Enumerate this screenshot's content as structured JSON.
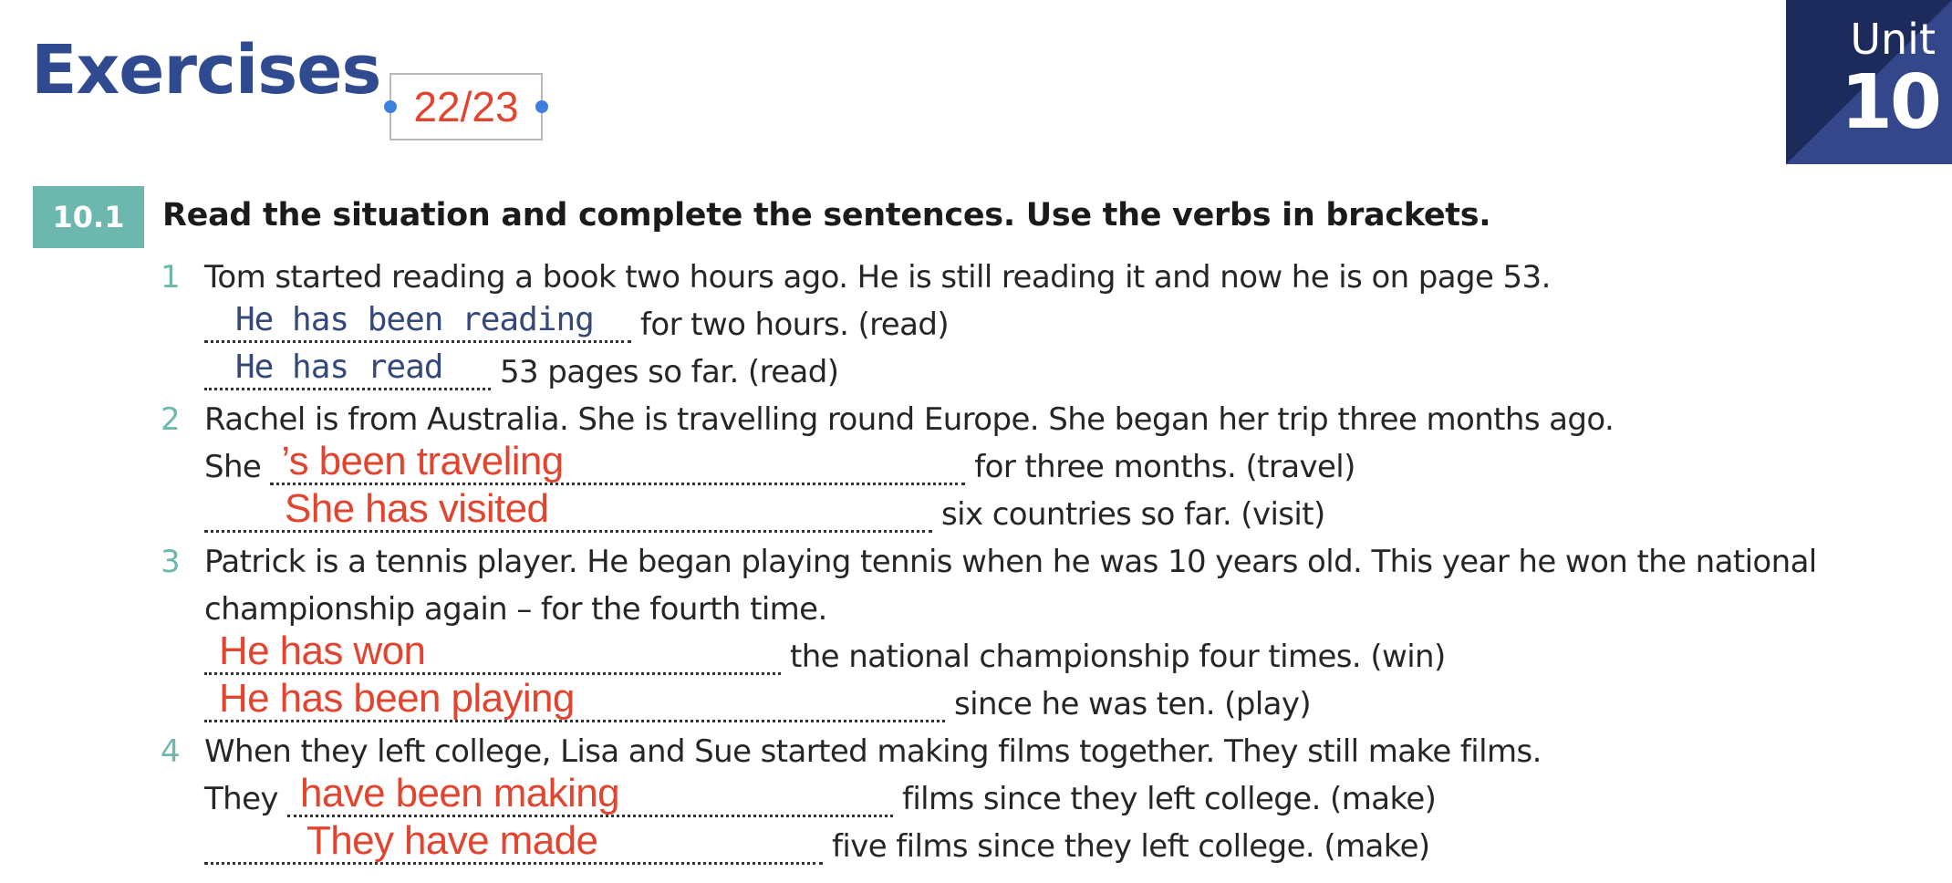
{
  "header": {
    "title": "Exercises",
    "page_indicator": "22/23",
    "unit_label": "Unit",
    "unit_number": "10"
  },
  "exercise": {
    "number": "10.1",
    "instruction": "Read the situation and complete the sentences.  Use the verbs in brackets.",
    "items": [
      {
        "number": "1",
        "situation": "Tom started reading a book two hours ago.  He is still reading it and now he is on page 53.",
        "sentences": [
          {
            "answer": "He has been reading",
            "rest": "for two hours.   (read)"
          },
          {
            "answer": "He has read",
            "rest": "53 pages so far.   (read)"
          }
        ]
      },
      {
        "number": "2",
        "situation": "Rachel is from Australia.  She is travelling round Europe.  She began her trip three months ago.",
        "sentences": [
          {
            "prefix": "She",
            "answer": "’s been traveling",
            "rest": "for three months.   (travel)"
          },
          {
            "answer": "She has visited",
            "rest": "six countries so far.   (visit)"
          }
        ]
      },
      {
        "number": "3",
        "situation_lines": [
          "Patrick is a tennis player.  He began playing tennis when he was 10 years old.  This year he won the national",
          "championship again – for the fourth time."
        ],
        "sentences": [
          {
            "answer": "He has won",
            "rest": "the national championship four times.   (win)"
          },
          {
            "answer": "He has been playing",
            "rest": "since he was ten.   (play)"
          }
        ]
      },
      {
        "number": "4",
        "situation": "When they left college, Lisa and Sue started making films together.  They still make films.",
        "sentences": [
          {
            "prefix": "They",
            "answer": "have been making",
            "rest": "films since they left college.   (make)"
          },
          {
            "answer": "They have made",
            "rest": "five films since they left college.   (make)"
          }
        ]
      }
    ]
  },
  "colors": {
    "title_blue": "#2f4a8f",
    "teal": "#6db8ae",
    "answer_red": "#e2452f",
    "handwriting_blue": "#34487a",
    "unit_dark": "#1d2a5c",
    "unit_light": "#34478a"
  }
}
